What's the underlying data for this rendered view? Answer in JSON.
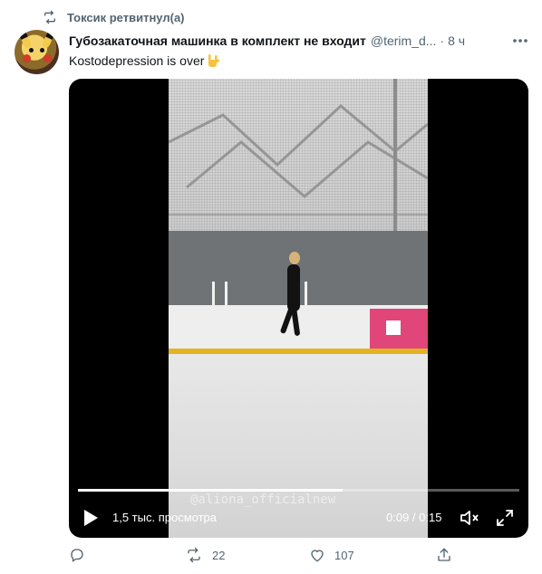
{
  "retweet": {
    "text": "Токсик ретвитнул(а)",
    "icon": "retweet-icon"
  },
  "tweet": {
    "author_name": "Губозакаточная машинка в комплект не входит",
    "author_handle": "@terim_d...",
    "separator": "·",
    "time": "8 ч",
    "text": "Kostodepression is over",
    "emoji": "sign-of-horns-emoji"
  },
  "video": {
    "watermark": "@aliona_officialnew",
    "views": "1,5 тыс. просмотра",
    "timecode": "0:09 / 0:15",
    "progress": 0.6
  },
  "actions": {
    "reply": "",
    "retweets": "22",
    "likes": "107"
  },
  "colors": {
    "text_primary": "#0f1419",
    "text_secondary": "#536471",
    "video_background": "#000000"
  }
}
